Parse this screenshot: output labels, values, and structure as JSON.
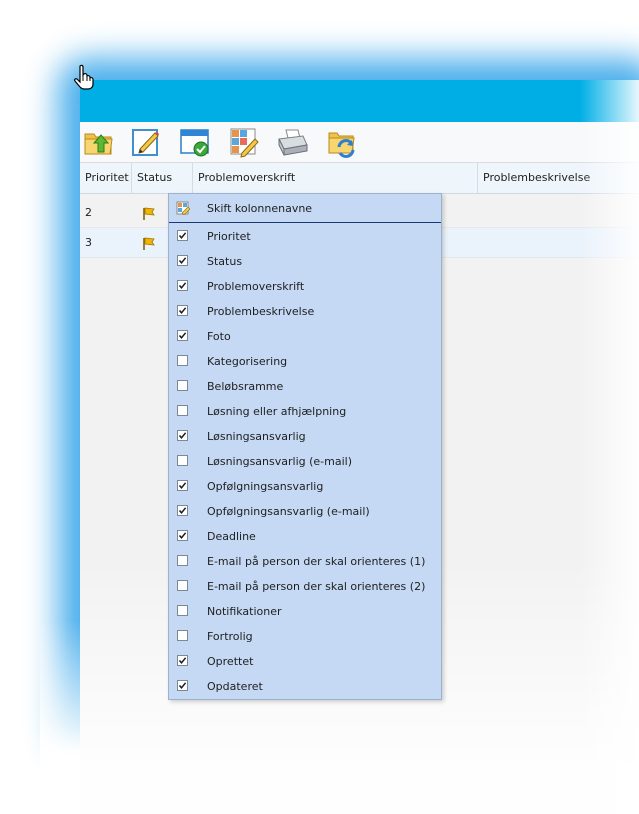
{
  "columns": {
    "priority": "Prioritet",
    "status": "Status",
    "title": "Problemoverskrift",
    "description": "Problembeskrivelse"
  },
  "rows": [
    {
      "priority": "2",
      "status_icon": "yellow-flag-icon"
    },
    {
      "priority": "3",
      "status_icon": "yellow-flag-icon"
    }
  ],
  "toolbar": {
    "icons": [
      "folder-up-icon",
      "edit-pencil-icon",
      "window-check-icon",
      "grid-edit-icon",
      "printer-icon",
      "folder-refresh-icon"
    ]
  },
  "menu": {
    "header_label": "Skift kolonnenavne",
    "items": [
      {
        "label": "Prioritet",
        "checked": true
      },
      {
        "label": "Status",
        "checked": true
      },
      {
        "label": "Problemoverskrift",
        "checked": true
      },
      {
        "label": "Problembeskrivelse",
        "checked": true
      },
      {
        "label": "Foto",
        "checked": true
      },
      {
        "label": "Kategorisering",
        "checked": false
      },
      {
        "label": "Beløbsramme",
        "checked": false
      },
      {
        "label": "Løsning eller afhjælpning",
        "checked": false
      },
      {
        "label": "Løsningsansvarlig",
        "checked": true
      },
      {
        "label": "Løsningsansvarlig (e-mail)",
        "checked": false
      },
      {
        "label": "Opfølgningsansvarlig",
        "checked": true
      },
      {
        "label": "Opfølgningsansvarlig (e-mail)",
        "checked": true
      },
      {
        "label": "Deadline",
        "checked": true
      },
      {
        "label": "E-mail på person der skal orienteres (1)",
        "checked": false
      },
      {
        "label": "E-mail på person der skal orienteres (2)",
        "checked": false
      },
      {
        "label": "Notifikationer",
        "checked": false
      },
      {
        "label": "Fortrolig",
        "checked": false
      },
      {
        "label": "Oprettet",
        "checked": true
      },
      {
        "label": "Opdateret",
        "checked": true
      }
    ]
  },
  "colors": {
    "titlebar": "#00aee6",
    "menu_bg": "#c5d9f4",
    "flag": "#f2b400"
  }
}
